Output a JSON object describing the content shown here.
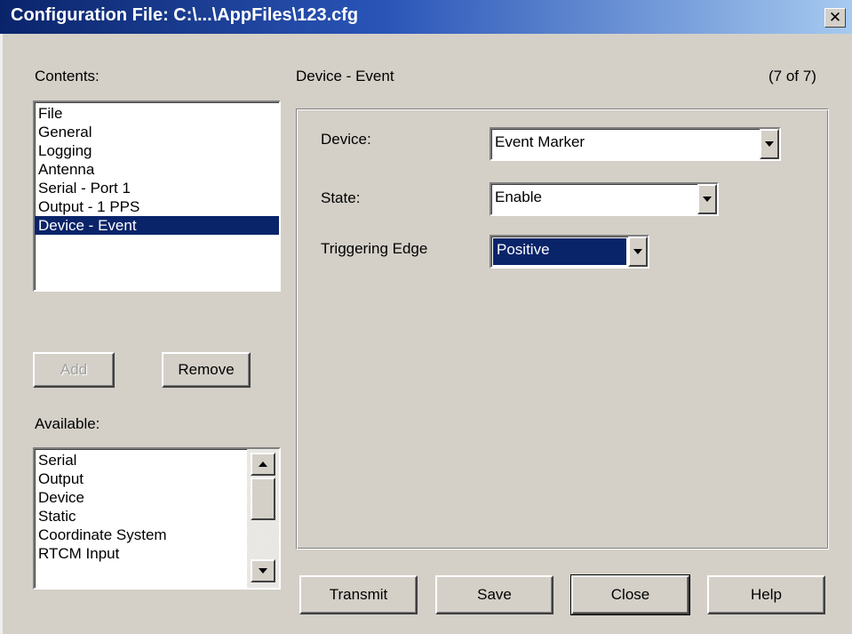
{
  "window": {
    "title": "Configuration File: C:\\...\\AppFiles\\123.cfg",
    "close_glyph": "✕"
  },
  "contents": {
    "label": "Contents:",
    "items": [
      "File",
      "General",
      "Logging",
      "Antenna",
      "Serial - Port 1",
      "Output - 1 PPS",
      "Device - Event"
    ],
    "selected_index": 6
  },
  "actions": {
    "add_label": "Add",
    "remove_label": "Remove"
  },
  "available": {
    "label": "Available:",
    "items": [
      "Serial",
      "Output",
      "Device",
      "Static",
      "Coordinate System",
      "RTCM Input"
    ]
  },
  "section": {
    "title": "Device - Event",
    "counter": "(7 of 7)"
  },
  "form": {
    "device": {
      "label": "Device:",
      "value": "Event Marker"
    },
    "state": {
      "label": "State:",
      "value": "Enable"
    },
    "edge": {
      "label": "Triggering Edge",
      "value": "Positive"
    }
  },
  "footer": {
    "transmit_label": "Transmit",
    "save_label": "Save",
    "close_label": "Close",
    "help_label": "Help"
  },
  "colors": {
    "face": "#d4d0c8",
    "selection": "#0a246a",
    "titlebar_start": "#0a246a",
    "titlebar_end": "#a6caf0"
  }
}
